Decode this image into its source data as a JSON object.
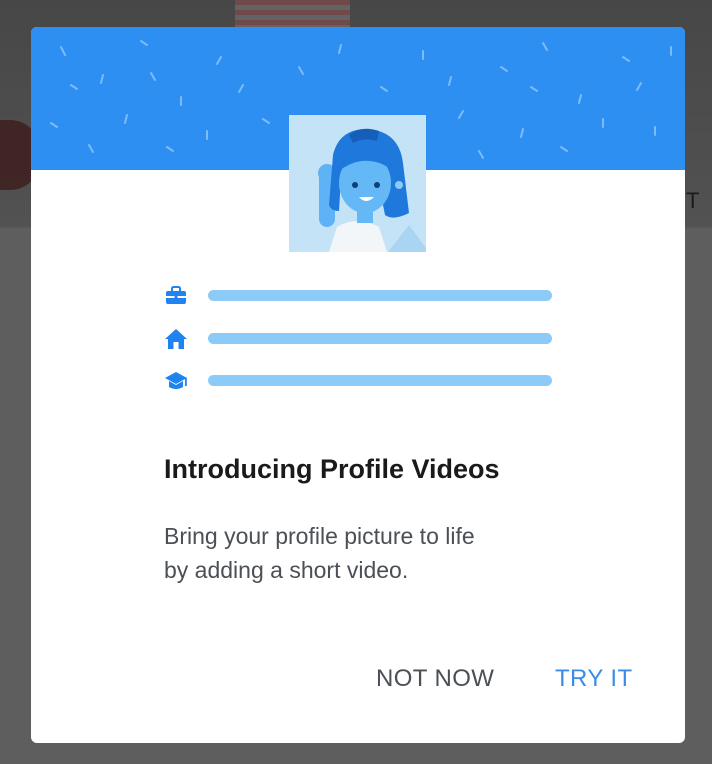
{
  "background": {
    "partial_text": "T"
  },
  "dialog": {
    "banner_color": "#2d8ff2",
    "illustration": "profile-avatar-illustration",
    "rows": [
      {
        "icon": "briefcase-icon"
      },
      {
        "icon": "home-icon"
      },
      {
        "icon": "graduation-cap-icon"
      }
    ],
    "title": "Introducing Profile Videos",
    "body_line1": "Bring your profile picture to life",
    "body_line2": "by adding a short video.",
    "not_now_label": "NOT NOW",
    "try_it_label": "TRY IT",
    "accent_color": "#3a8ce8"
  }
}
